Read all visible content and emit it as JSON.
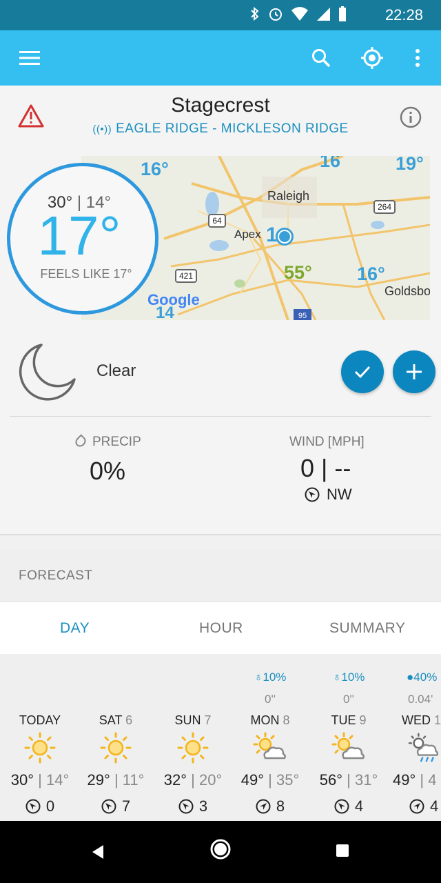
{
  "status_bar": {
    "time": "22:28",
    "icons": [
      "bluetooth-icon",
      "alarm-icon",
      "wifi-icon",
      "signal-icon",
      "battery-icon"
    ]
  },
  "app_bar": {
    "icons": [
      "menu-icon",
      "search-icon",
      "locate-icon",
      "more-icon"
    ],
    "color": "#35bff0"
  },
  "location": {
    "name": "Stagecrest",
    "station": "EAGLE RIDGE - MICKLESON RIDGE"
  },
  "current": {
    "high": "30°",
    "low": "14°",
    "temp": "17°",
    "feels_like": "FEELS LIKE 17°",
    "condition": "Clear"
  },
  "map": {
    "labels": [
      "Raleigh",
      "Apex",
      "Goldsbo",
      "Google"
    ],
    "temps": [
      "16°",
      "16",
      "19°",
      "55°",
      "16°",
      "14"
    ],
    "routes": [
      "64",
      "264",
      "421",
      "95"
    ]
  },
  "stats": {
    "precip_label": "PRECIP",
    "precip_value": "0%",
    "wind_label": "WIND [MPH]",
    "wind_value": "0 | --",
    "wind_dir": "NW"
  },
  "forecast": {
    "title": "FORECAST",
    "tabs": [
      "DAY",
      "HOUR",
      "SUMMARY"
    ],
    "active_tab": "DAY",
    "days": [
      {
        "precip": "",
        "amount": "",
        "name": "TODAY",
        "num": "",
        "icon": "sun-icon",
        "hi": "30°",
        "lo": "14°",
        "wind": "0"
      },
      {
        "precip": "",
        "amount": "",
        "name": "SAT",
        "num": "6",
        "icon": "sun-icon",
        "hi": "29°",
        "lo": "11°",
        "wind": "7"
      },
      {
        "precip": "",
        "amount": "",
        "name": "SUN",
        "num": "7",
        "icon": "sun-icon",
        "hi": "32°",
        "lo": "20°",
        "wind": "3"
      },
      {
        "precip": "10%",
        "amount": "0''",
        "name": "MON",
        "num": "8",
        "icon": "partly-cloudy-icon",
        "hi": "49°",
        "lo": "35°",
        "wind": "8"
      },
      {
        "precip": "10%",
        "amount": "0''",
        "name": "TUE",
        "num": "9",
        "icon": "partly-cloudy-icon",
        "hi": "56°",
        "lo": "31°",
        "wind": "4"
      },
      {
        "precip": "40%",
        "amount": "0.04'",
        "name": "WED",
        "num": "1",
        "icon": "rain-cloud-icon",
        "hi": "49°",
        "lo": "4",
        "wind": "4"
      }
    ]
  },
  "colors": {
    "accent": "#1a8fbf",
    "ring": "#2d98de",
    "fab": "#0c86be",
    "status_bar": "#177c9c"
  }
}
